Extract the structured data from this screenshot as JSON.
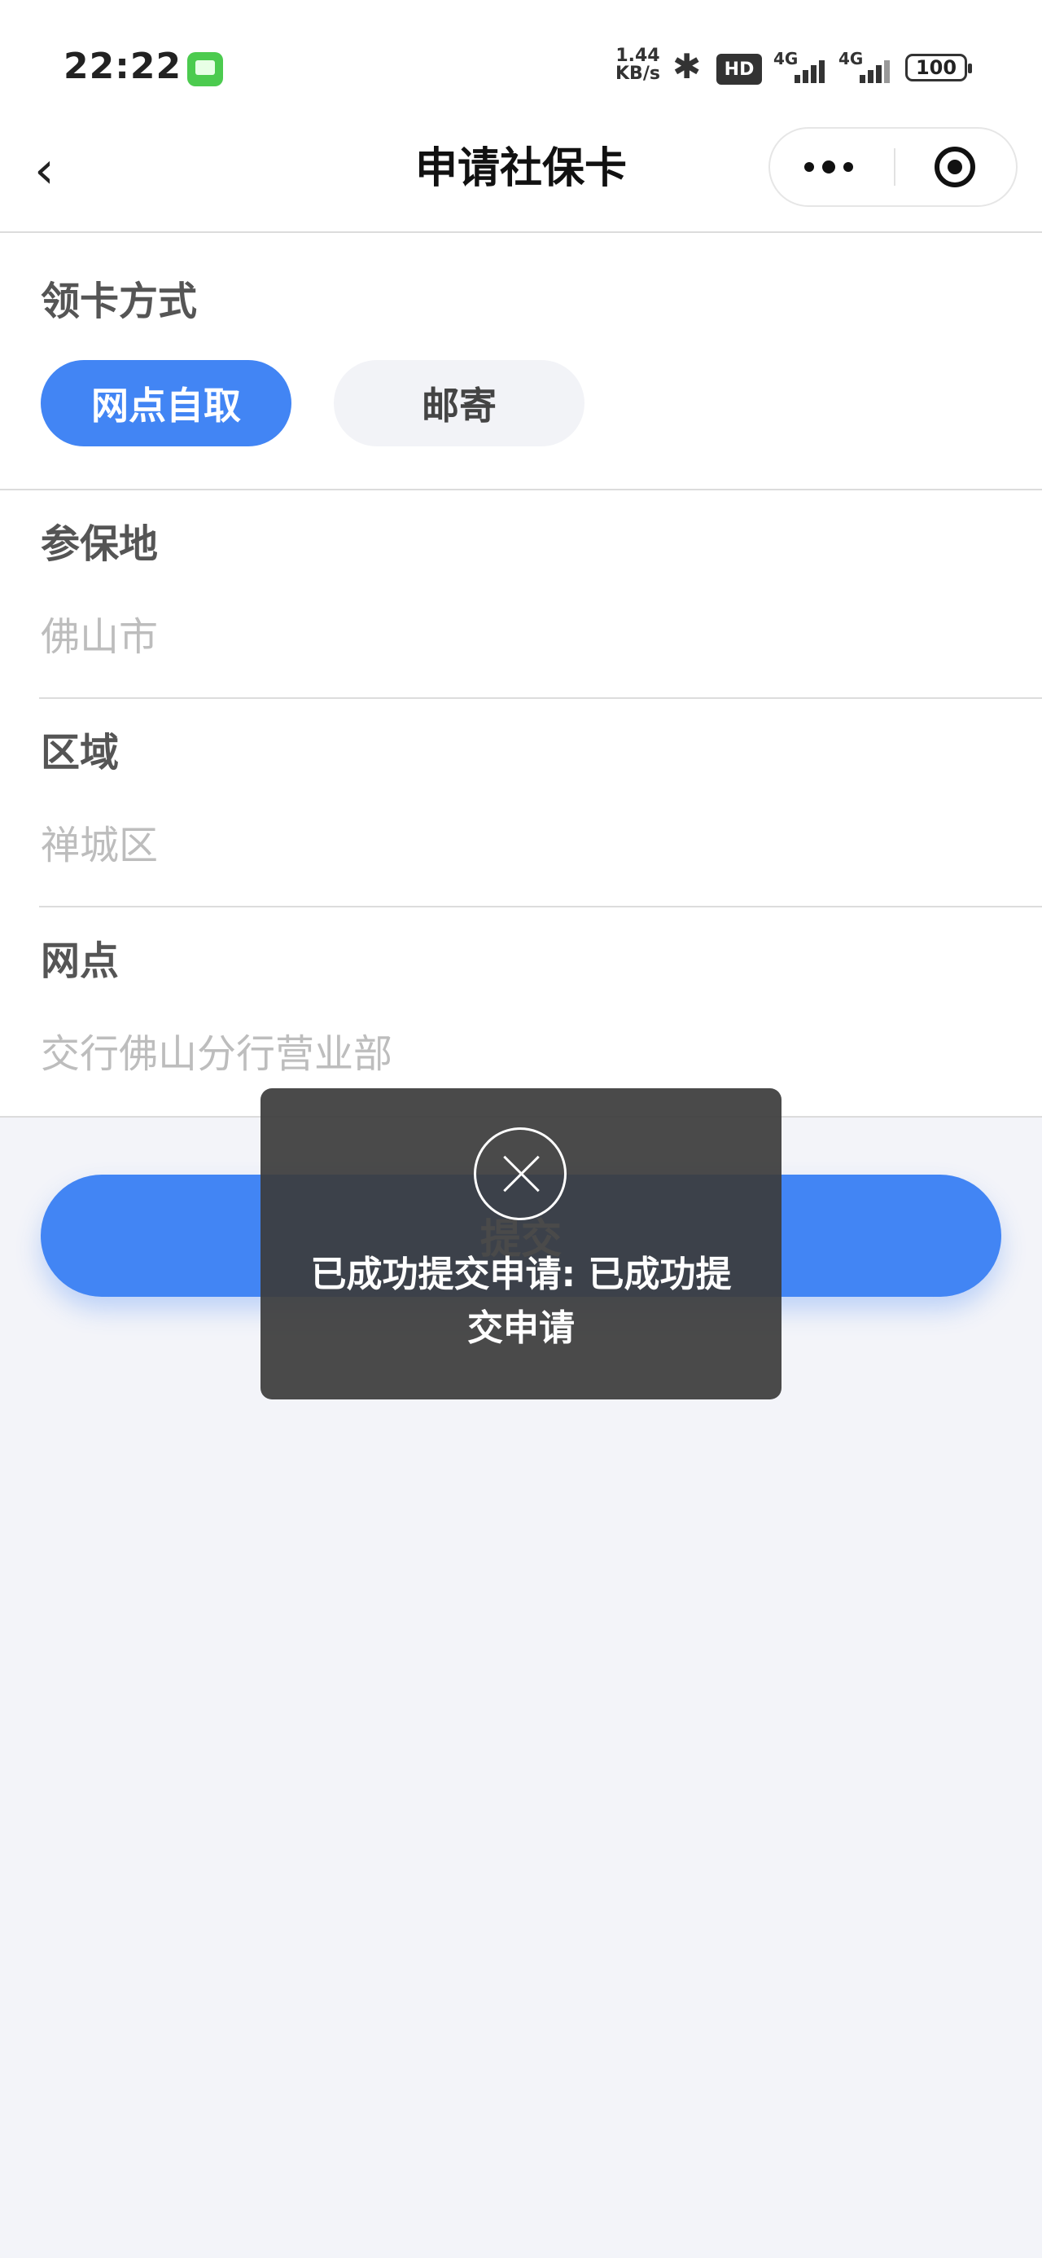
{
  "status_bar": {
    "time": "22:22",
    "net_speed_value": "1.44",
    "net_speed_unit": "KB/s",
    "bluetooth_icon": "bluetooth-icon",
    "hd_badge": "HD",
    "signal1_label": "4G",
    "signal2_label": "4G",
    "battery": "100"
  },
  "nav": {
    "title": "申请社保卡"
  },
  "method": {
    "label": "领卡方式",
    "options": [
      {
        "label": "网点自取",
        "selected": true
      },
      {
        "label": "邮寄",
        "selected": false
      }
    ]
  },
  "fields": [
    {
      "label": "参保地",
      "value": "佛山市"
    },
    {
      "label": "区域",
      "value": "禅城区"
    },
    {
      "label": "网点",
      "value": "交行佛山分行营业部"
    }
  ],
  "submit_label": "提交",
  "toast": {
    "icon": "close-circle-icon",
    "message": "已成功提交申请: 已成功提交申请"
  },
  "colors": {
    "accent": "#4285f4",
    "background": "#f3f4f9",
    "toast_bg": "#3c3c3c"
  }
}
